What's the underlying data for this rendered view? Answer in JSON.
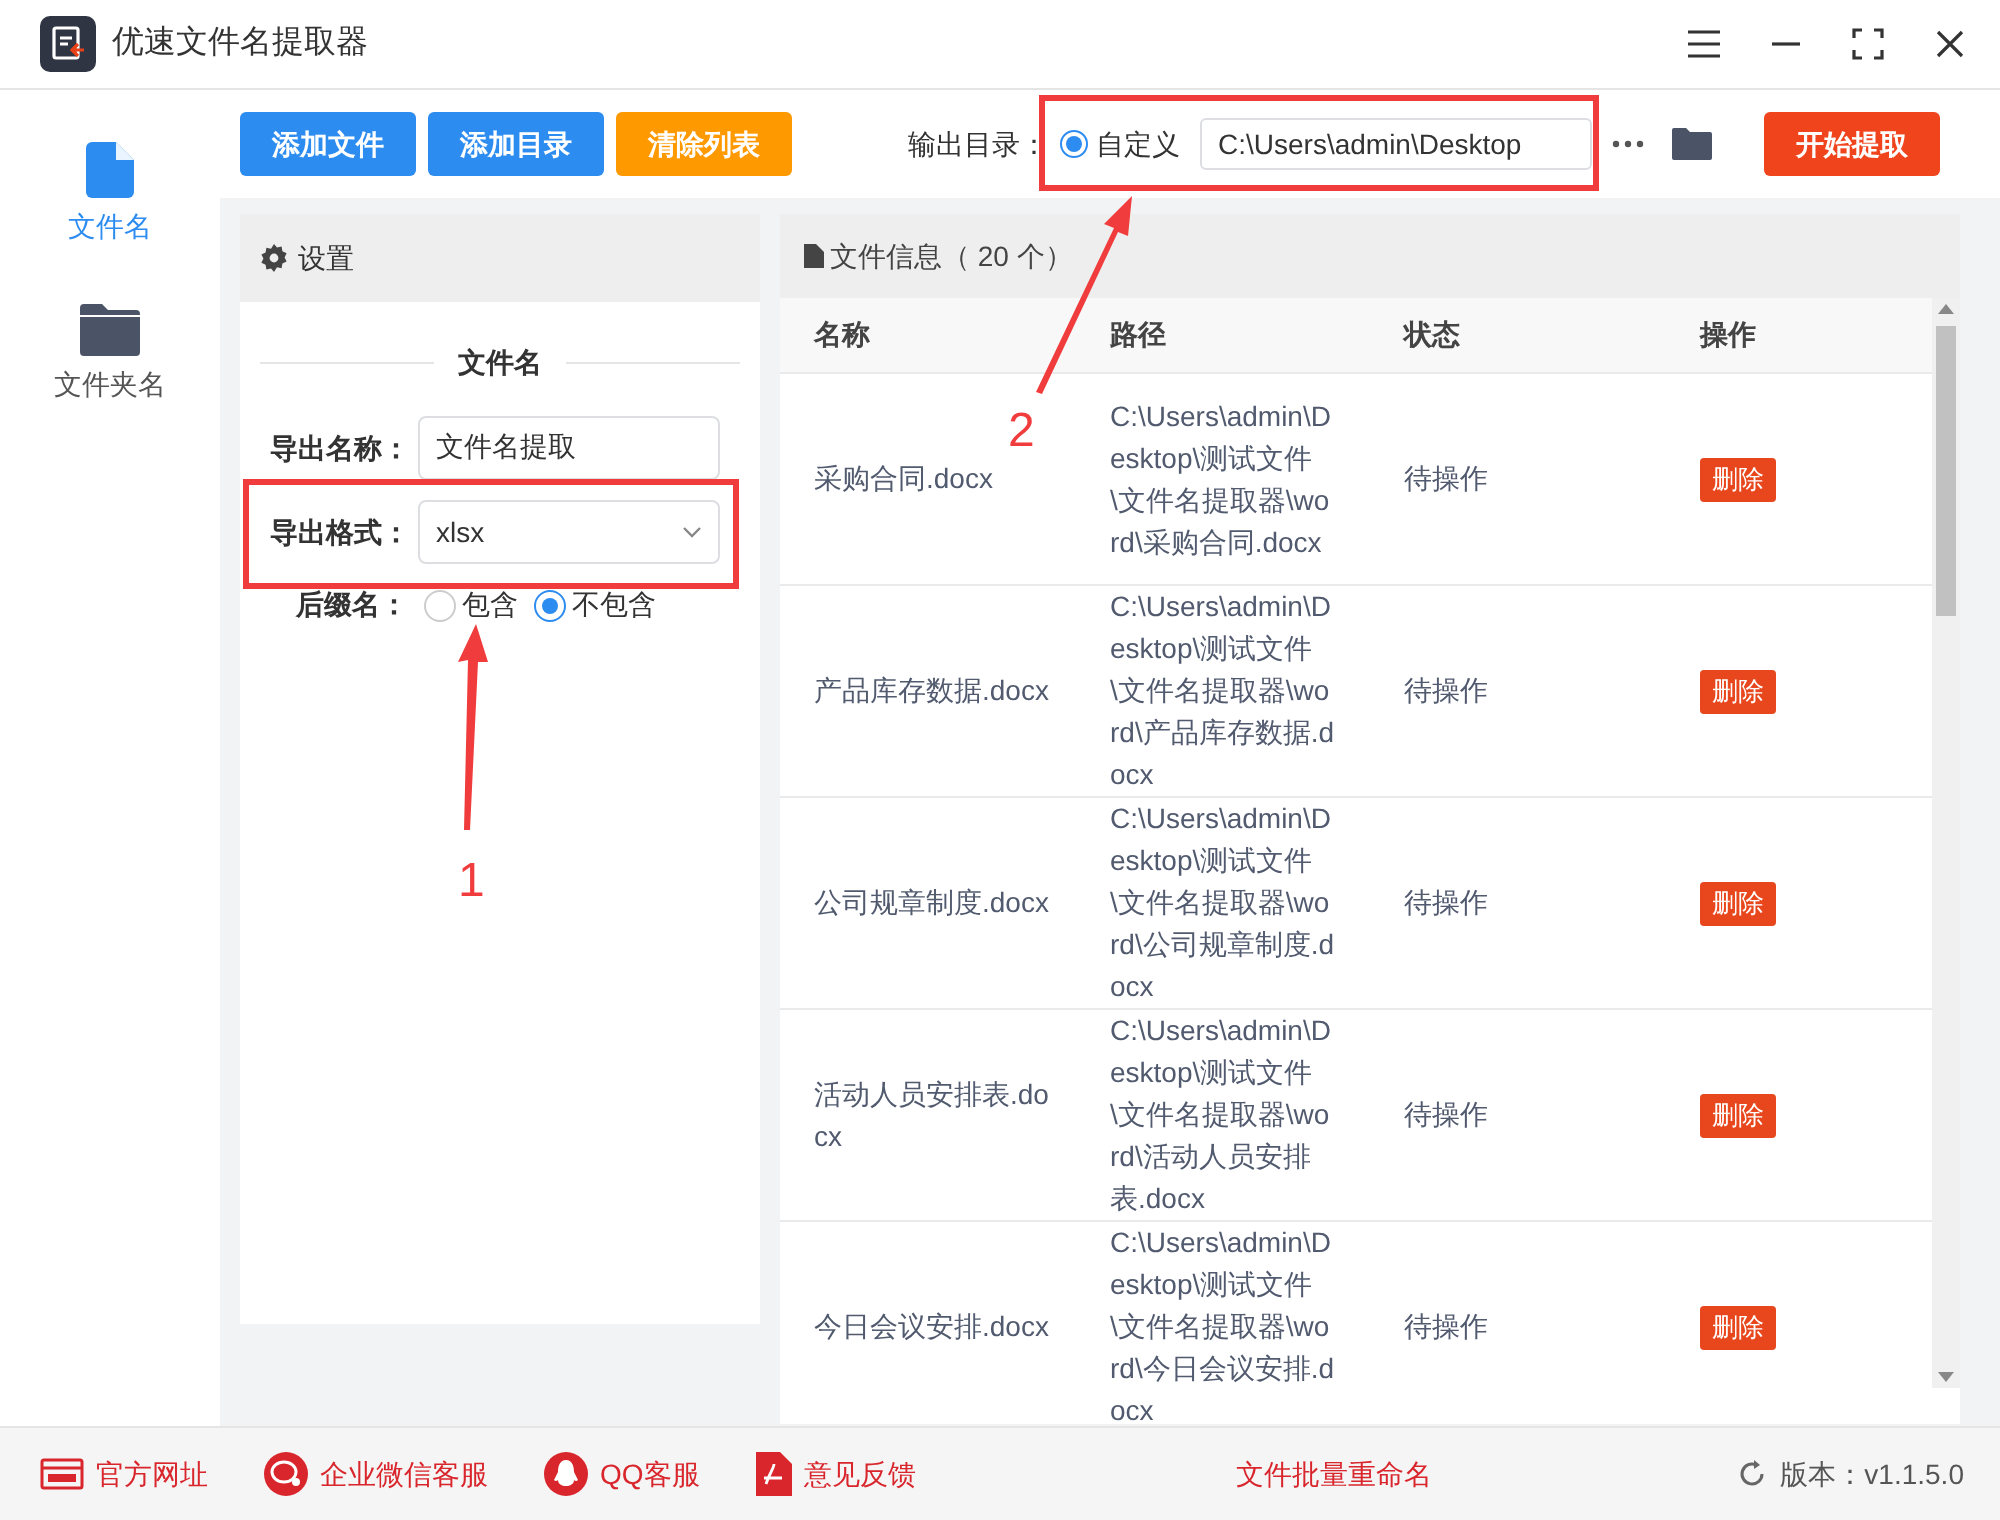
{
  "window": {
    "title": "优速文件名提取器"
  },
  "toolbar": {
    "buttons": [
      {
        "label": "添加文件",
        "kind": "primary"
      },
      {
        "label": "添加目录",
        "kind": "primary"
      },
      {
        "label": "清除列表",
        "kind": "warning"
      }
    ],
    "output_label": "输出目录：",
    "output_radio": {
      "label": "自定义",
      "selected": true
    },
    "output_path": "C:\\Users\\admin\\Desktop",
    "start_button": "开始提取"
  },
  "sidebar": {
    "items": [
      {
        "label": "文件名",
        "selected": true,
        "kind": "file"
      },
      {
        "label": "文件夹名",
        "selected": false,
        "kind": "folder"
      }
    ]
  },
  "settings": {
    "title": "设置",
    "section": "文件名",
    "name_label": "导出名称：",
    "name_value": "文件名提取",
    "format_label": "导出格式：",
    "format_value": "xlsx",
    "suffix_label": "后缀名：",
    "suffix_options": [
      {
        "label": "包含",
        "selected": false
      },
      {
        "label": "不包含",
        "selected": true
      }
    ]
  },
  "files": {
    "title": "文件信息（ 20 个）",
    "columns": [
      "名称",
      "路径",
      "状态",
      "操作"
    ],
    "rows": [
      {
        "name": "采购合同.docx",
        "path": "C:\\Users\\admin\\Desktop\\测试文件\\文件名提取器\\word\\采购合同.docx",
        "status": "待操作",
        "action": "删除"
      },
      {
        "name": "产品库存数据.docx",
        "path": "C:\\Users\\admin\\Desktop\\测试文件\\文件名提取器\\word\\产品库存数据.docx",
        "status": "待操作",
        "action": "删除"
      },
      {
        "name": "公司规章制度.docx",
        "path": "C:\\Users\\admin\\Desktop\\测试文件\\文件名提取器\\word\\公司规章制度.docx",
        "status": "待操作",
        "action": "删除"
      },
      {
        "name": "活动人员安排表.docx",
        "path": "C:\\Users\\admin\\Desktop\\测试文件\\文件名提取器\\word\\活动人员安排表.docx",
        "status": "待操作",
        "action": "删除"
      },
      {
        "name": "今日会议安排.docx",
        "path": "C:\\Users\\admin\\Desktop\\测试文件\\文件名提取器\\word\\今日会议安排.docx",
        "status": "待操作",
        "action": "删除"
      }
    ]
  },
  "footer": {
    "links": [
      {
        "label": "官方网址",
        "kind": "web"
      },
      {
        "label": "企业微信客服",
        "kind": "chat"
      },
      {
        "label": "QQ客服",
        "kind": "qq"
      },
      {
        "label": "意见反馈",
        "kind": "feedback"
      }
    ],
    "center": "文件批量重命名",
    "version": "版本：v1.1.5.0"
  },
  "annotations": [
    {
      "label": "1"
    },
    {
      "label": "2"
    }
  ]
}
